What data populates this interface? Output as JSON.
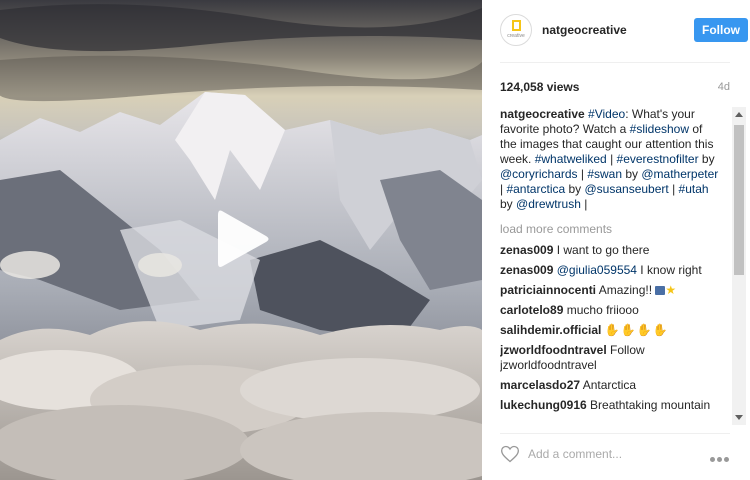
{
  "post": {
    "username": "natgeocreative",
    "avatar_text": "creative",
    "follow_label": "Follow",
    "views": "124,058 views",
    "age": "4d",
    "caption": [
      {
        "t": "natgeocreative",
        "k": "u"
      },
      {
        "t": " ",
        "k": "p"
      },
      {
        "t": "#Video",
        "k": "l"
      },
      {
        "t": ": What's your favorite photo? Watch a ",
        "k": "p"
      },
      {
        "t": "#slideshow",
        "k": "l"
      },
      {
        "t": " of the images that caught our attention this week. ",
        "k": "p"
      },
      {
        "t": "#whatweliked",
        "k": "l"
      },
      {
        "t": " | ",
        "k": "p"
      },
      {
        "t": "#everestnofilter",
        "k": "l"
      },
      {
        "t": " by ",
        "k": "p"
      },
      {
        "t": "@coryrichards",
        "k": "l"
      },
      {
        "t": " | ",
        "k": "p"
      },
      {
        "t": "#swan",
        "k": "l"
      },
      {
        "t": " by ",
        "k": "p"
      },
      {
        "t": "@matherpeter",
        "k": "l"
      },
      {
        "t": " | ",
        "k": "p"
      },
      {
        "t": "#antarctica",
        "k": "l"
      },
      {
        "t": " by ",
        "k": "p"
      },
      {
        "t": "@susanseubert",
        "k": "l"
      },
      {
        "t": " | ",
        "k": "p"
      },
      {
        "t": "#utah",
        "k": "l"
      },
      {
        "t": " by ",
        "k": "p"
      },
      {
        "t": "@drewtrush",
        "k": "l"
      },
      {
        "t": " |",
        "k": "p"
      }
    ],
    "load_more": "load more comments",
    "comments": [
      {
        "user": "zenas009",
        "parts": [
          {
            "t": "I want to go there",
            "k": "p"
          }
        ]
      },
      {
        "user": "zenas009",
        "parts": [
          {
            "t": "@giulia059554",
            "k": "l"
          },
          {
            "t": " I know right",
            "k": "p"
          }
        ]
      },
      {
        "user": "patriciainnocenti",
        "parts": [
          {
            "t": "Amazing!! ",
            "k": "p"
          }
        ],
        "icons": [
          "photo-emoji-icon",
          "star-emoji-icon"
        ]
      },
      {
        "user": "carlotelo89",
        "parts": [
          {
            "t": "mucho friiooo",
            "k": "p"
          }
        ]
      },
      {
        "user": "salihdemir.official",
        "parts": [],
        "icons": [
          "thumbs-up-emoji-icon"
        ]
      },
      {
        "user": "jzworldfoodntravel",
        "parts": [
          {
            "t": "Follow jzworldfoodntravel",
            "k": "p"
          }
        ]
      },
      {
        "user": "marcelasdo27",
        "parts": [
          {
            "t": "Antarctica",
            "k": "p"
          }
        ]
      },
      {
        "user": "lukechung0916",
        "parts": [
          {
            "t": "Breathtaking mountain",
            "k": "p"
          }
        ]
      }
    ],
    "add_comment_placeholder": "Add a comment...",
    "icons": {
      "play": "play-icon",
      "heart": "heart-icon",
      "more": "more-options-icon"
    },
    "colors": {
      "follow_bg": "#3897f0",
      "link": "#003569",
      "muted": "#999999"
    }
  }
}
